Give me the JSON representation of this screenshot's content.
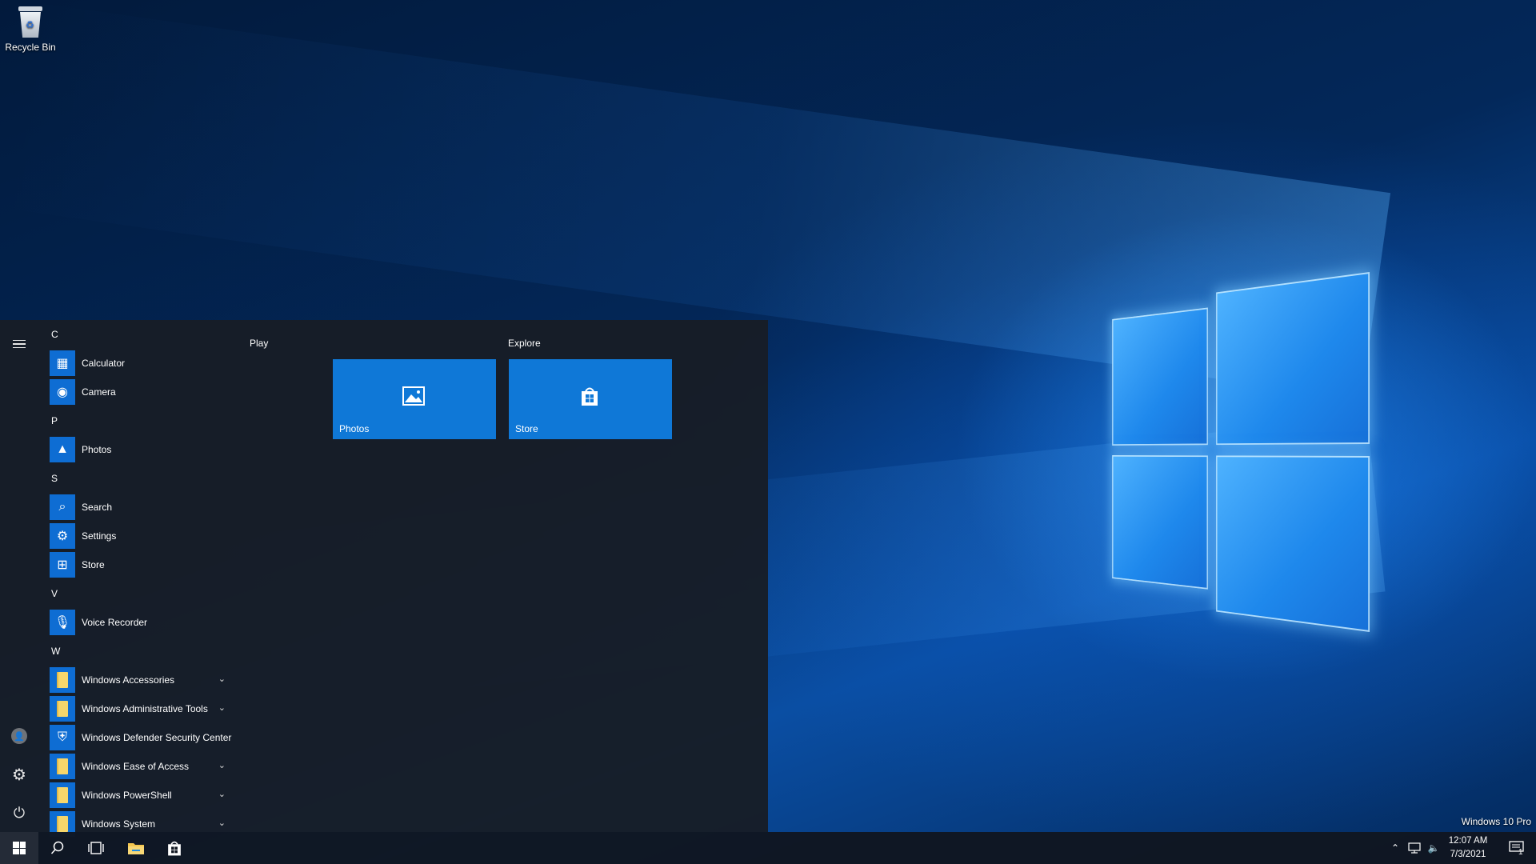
{
  "desktop": {
    "icons": [
      {
        "label": "Recycle Bin",
        "icon": "recycle-bin-icon"
      }
    ],
    "edition_text": "Windows 10 Pro"
  },
  "start_menu": {
    "groups": [
      {
        "letter": "C",
        "apps": [
          {
            "label": "Calculator",
            "icon": "calculator-icon"
          },
          {
            "label": "Camera",
            "icon": "camera-icon"
          }
        ]
      },
      {
        "letter": "P",
        "apps": [
          {
            "label": "Photos",
            "icon": "photos-icon"
          }
        ]
      },
      {
        "letter": "S",
        "apps": [
          {
            "label": "Search",
            "icon": "search-icon"
          },
          {
            "label": "Settings",
            "icon": "gear-icon"
          },
          {
            "label": "Store",
            "icon": "store-icon"
          }
        ]
      },
      {
        "letter": "V",
        "apps": [
          {
            "label": "Voice Recorder",
            "icon": "microphone-icon"
          }
        ]
      },
      {
        "letter": "W",
        "apps": [
          {
            "label": "Windows Accessories",
            "icon": "folder-icon",
            "expandable": true
          },
          {
            "label": "Windows Administrative Tools",
            "icon": "folder-icon",
            "expandable": true
          },
          {
            "label": "Windows Defender Security Center",
            "icon": "shield-icon"
          },
          {
            "label": "Windows Ease of Access",
            "icon": "folder-icon",
            "expandable": true
          },
          {
            "label": "Windows PowerShell",
            "icon": "folder-icon",
            "expandable": true
          },
          {
            "label": "Windows System",
            "icon": "folder-icon",
            "expandable": true
          }
        ]
      }
    ],
    "tile_groups": [
      {
        "label": "Play",
        "tiles": []
      },
      {
        "label": "Explore",
        "tiles": []
      }
    ],
    "tiles": [
      {
        "label": "Photos",
        "icon": "photos-icon"
      },
      {
        "label": "Store",
        "icon": "store-icon"
      }
    ]
  },
  "taskbar": {
    "pinned": [
      "start-icon",
      "search-icon",
      "task-view-icon",
      "file-explorer-icon",
      "store-icon"
    ],
    "tray": {
      "time": "12:07 AM",
      "date": "7/3/2021",
      "notification_count": "1"
    }
  },
  "colors": {
    "accent": "#0f78d7",
    "start_bg": "#171d26",
    "taskbar_bg": "#101620"
  }
}
